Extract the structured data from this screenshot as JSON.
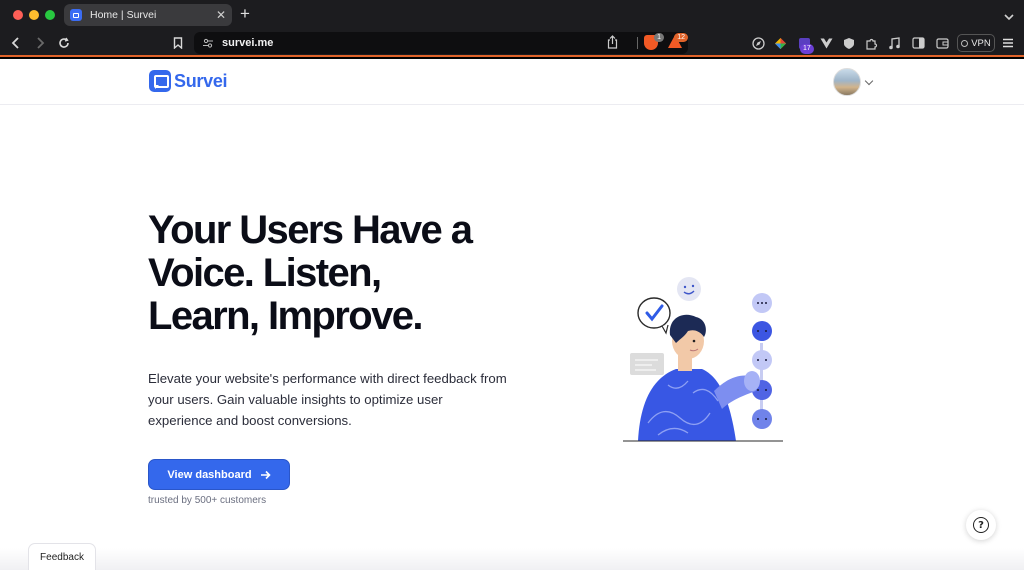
{
  "browser": {
    "tab_title": "Home | Survei",
    "url": "survei.me",
    "brave_shield_count": "1",
    "rewards_count": "12",
    "extension_badge": "17",
    "vpn_label": "VPN",
    "accent_color": "#e0632a"
  },
  "header": {
    "logo_text": "Survei",
    "brand_color": "#3468ec"
  },
  "hero": {
    "title_line1": "Your Users Have a",
    "title_line2": "Voice. Listen,",
    "title_line3": "Learn, Improve.",
    "body": "Elevate your website's performance with direct feedback from your users. Gain valuable insights to optimize user experience and boost conversions.",
    "cta_label": "View dashboard",
    "trusted_text": "trusted by 500+ customers"
  },
  "widgets": {
    "help_icon": "?",
    "feedback_label": "Feedback"
  }
}
